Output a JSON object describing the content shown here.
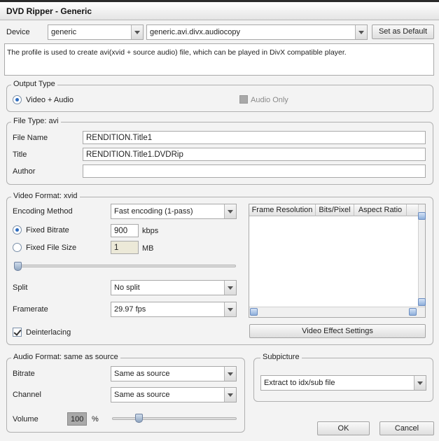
{
  "window": {
    "title": "DVD Ripper - Generic"
  },
  "device": {
    "label": "Device",
    "device_value": "generic",
    "profile_value": "generic.avi.divx.audiocopy",
    "set_default_label": "Set as Default",
    "description": "The profile is used to create avi(xvid + source audio) file, which can be played in DivX compatible player."
  },
  "output_type": {
    "legend": "Output Type",
    "video_audio_label": "Video + Audio",
    "video_audio_selected": true,
    "audio_only_label": "Audio Only",
    "audio_only_checked": false
  },
  "file_type": {
    "legend": "File Type: avi",
    "file_name_label": "File Name",
    "file_name_value": "RENDITION.Title1",
    "title_label": "Title",
    "title_value": "RENDITION.Title1.DVDRip",
    "author_label": "Author",
    "author_value": ""
  },
  "video_format": {
    "legend": "Video Format: xvid",
    "encoding_method_label": "Encoding Method",
    "encoding_method_value": "Fast encoding (1-pass)",
    "fixed_bitrate_label": "Fixed Bitrate",
    "fixed_bitrate_selected": true,
    "bitrate_value": "900",
    "bitrate_unit": "kbps",
    "fixed_file_size_label": "Fixed File Size",
    "file_size_value": "1",
    "file_size_unit": "MB",
    "quality_slider_level": 0.0,
    "split_label": "Split",
    "split_value": "No split",
    "framerate_label": "Framerate",
    "framerate_value": "29.97 fps",
    "deinterlacing_label": "Deinterlacing",
    "deinterlacing_checked": true,
    "table_columns": [
      "Frame Resolution",
      "Bits/Pixel",
      "Aspect Ratio"
    ],
    "video_effect_label": "Video Effect Settings"
  },
  "audio_format": {
    "legend": "Audio Format: same as source",
    "bitrate_label": "Bitrate",
    "bitrate_value": "Same as source",
    "channel_label": "Channel",
    "channel_value": "Same as source",
    "volume_label": "Volume",
    "volume_value": "100",
    "volume_unit": "%",
    "volume_slider_level": 0.2
  },
  "subpicture": {
    "legend": "Subpicture",
    "value": "Extract to idx/sub file"
  },
  "buttons": {
    "ok": "OK",
    "cancel": "Cancel"
  }
}
